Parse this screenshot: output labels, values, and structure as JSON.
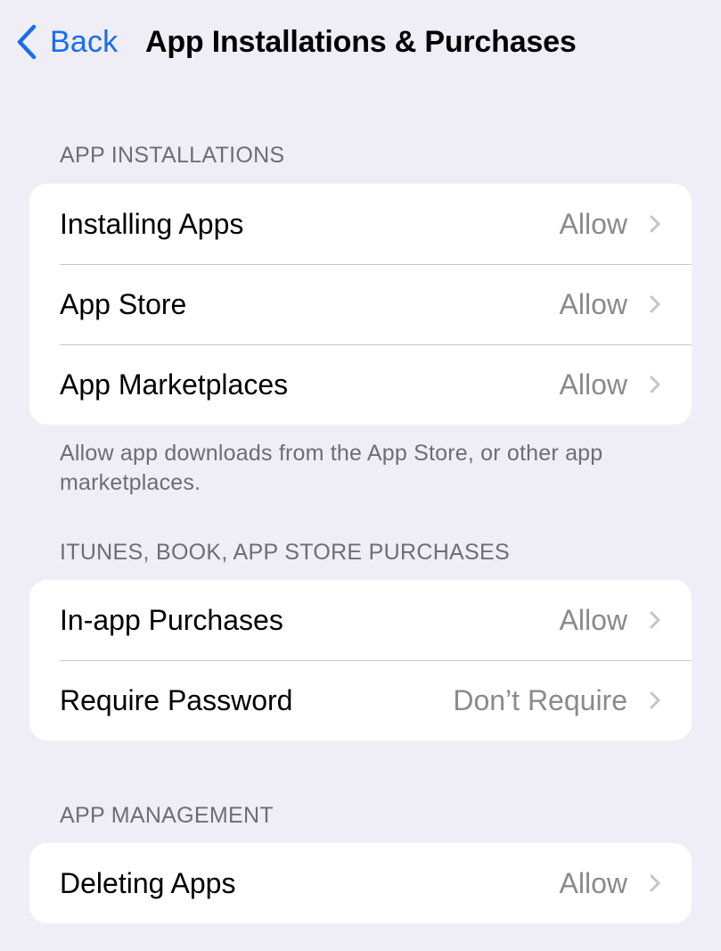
{
  "nav": {
    "back_label": "Back",
    "title": "App Installations & Purchases",
    "accent_color": "#1a6cf0"
  },
  "sections": [
    {
      "header": "APP INSTALLATIONS",
      "rows": [
        {
          "label": "Installing Apps",
          "value": "Allow"
        },
        {
          "label": "App Store",
          "value": "Allow"
        },
        {
          "label": "App Marketplaces",
          "value": "Allow"
        }
      ],
      "footer": "Allow app downloads from the App Store, or other app marketplaces."
    },
    {
      "header": "ITUNES, BOOK, APP STORE PURCHASES",
      "rows": [
        {
          "label": "In-app Purchases",
          "value": "Allow"
        },
        {
          "label": "Require Password",
          "value": "Don’t Require"
        }
      ]
    },
    {
      "header": "APP MANAGEMENT",
      "rows": [
        {
          "label": "Deleting Apps",
          "value": "Allow"
        }
      ]
    }
  ]
}
